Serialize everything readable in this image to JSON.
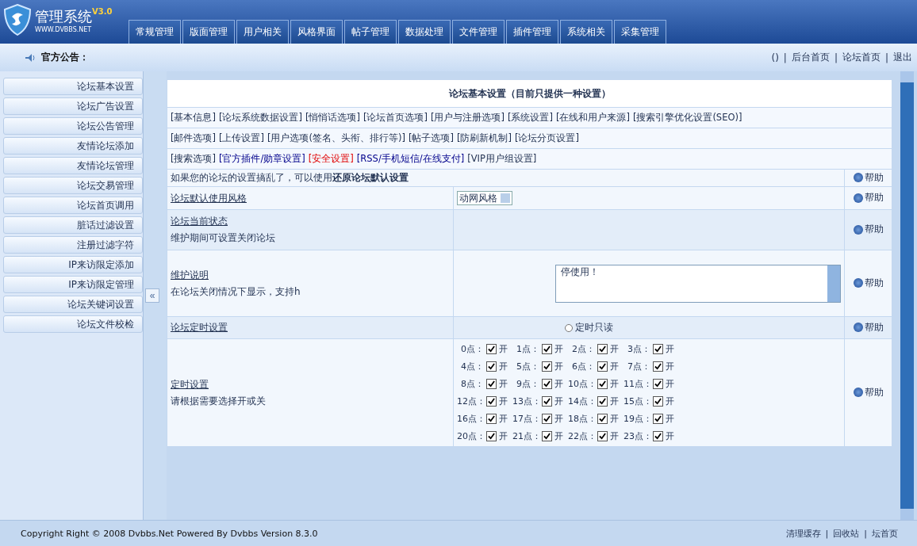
{
  "header": {
    "title": "管理系统",
    "version": "V3.0",
    "site": "WWW.DVBBS.NET",
    "tabs": [
      "常规管理",
      "版面管理",
      "用户相关",
      "风格界面",
      "帖子管理",
      "数据处理",
      "文件管理",
      "插件管理",
      "系统相关",
      "采集管理"
    ]
  },
  "notice_bar": {
    "label": "官方公告：",
    "separator": "|",
    "links": [
      "()",
      "后台首页",
      "论坛首页",
      "退出"
    ]
  },
  "sidebar": {
    "items": [
      "论坛基本设置",
      "论坛广告设置",
      "论坛公告管理",
      "友情论坛添加",
      "友情论坛管理",
      "论坛交易管理",
      "论坛首页调用",
      "脏话过滤设置",
      "注册过滤字符",
      "IP来访限定添加",
      "IP来访限定管理",
      "论坛关键词设置",
      "论坛文件校检"
    ],
    "collapse": "«"
  },
  "panel": {
    "title": "论坛基本设置（目前只提供一种设置）",
    "link_rows": [
      [
        {
          "text": "[基本信息]",
          "kind": "plain"
        },
        {
          "text": "[论坛系统数据设置]",
          "kind": "plain"
        },
        {
          "text": "[悄悄话选项]",
          "kind": "plain"
        },
        {
          "text": "[论坛首页选项]",
          "kind": "plain"
        },
        {
          "text": "[用户与注册选项]",
          "kind": "plain"
        },
        {
          "text": "[系统设置]",
          "kind": "plain"
        },
        {
          "text": "[在线和用户来源]",
          "kind": "plain"
        },
        {
          "text": "[搜索引擎优化设置(SEO)]",
          "kind": "plain"
        }
      ],
      [
        {
          "text": "[邮件选项]",
          "kind": "plain"
        },
        {
          "text": "[上传设置]",
          "kind": "plain"
        },
        {
          "text": "[用户选项(签名、头衔、排行等)]",
          "kind": "plain"
        },
        {
          "text": "[帖子选项]",
          "kind": "plain"
        },
        {
          "text": "[防刷新机制]",
          "kind": "plain"
        },
        {
          "text": "[论坛分页设置]",
          "kind": "plain"
        }
      ],
      [
        {
          "text": "[搜索选项]",
          "kind": "plain"
        },
        {
          "text": "[官方插件/勋章设置]",
          "kind": "featured"
        },
        {
          "text": "[安全设置]",
          "kind": "warning"
        },
        {
          "text": "[RSS/手机短信/在线支付]",
          "kind": "featured"
        },
        {
          "text": "[VIP用户组设置]",
          "kind": "plain"
        }
      ]
    ],
    "restore": {
      "text": "如果您的论坛的设置搞乱了，可以使用**还原论坛默认设置**",
      "help": "帮助"
    },
    "rows": [
      {
        "kind": "select",
        "label": "论坛默认使用风格",
        "value": "动网风格",
        "help": "帮助"
      },
      {
        "kind": "empty",
        "label": "论坛当前状态",
        "description": "维护期间可设置关闭论坛",
        "help": "帮助"
      },
      {
        "kind": "textarea",
        "label": "维护说明",
        "description": "在论坛关闭情况下显示，支持h",
        "value": "停使用！",
        "help": "帮助"
      },
      {
        "kind": "radio",
        "label": "论坛定时设置",
        "option": "定时只读",
        "selected": false,
        "help": "帮助"
      },
      {
        "kind": "hours",
        "label": "定时设置",
        "description": "请根据需要选择开或关",
        "help": "帮助",
        "hours": [
          {
            "label": "0点：",
            "checked": true,
            "text": "开"
          },
          {
            "label": "1点：",
            "checked": true,
            "text": "开"
          },
          {
            "label": "2点：",
            "checked": true,
            "text": "开"
          },
          {
            "label": "3点：",
            "checked": true,
            "text": "开"
          },
          {
            "label": "4点：",
            "checked": true,
            "text": "开"
          },
          {
            "label": "5点：",
            "checked": true,
            "text": "开"
          },
          {
            "label": "6点：",
            "checked": true,
            "text": "开"
          },
          {
            "label": "7点：",
            "checked": true,
            "text": "开"
          },
          {
            "label": "8点：",
            "checked": true,
            "text": "开"
          },
          {
            "label": "9点：",
            "checked": true,
            "text": "开"
          },
          {
            "label": "10点：",
            "checked": true,
            "text": "开"
          },
          {
            "label": "11点：",
            "checked": true,
            "text": "开"
          },
          {
            "label": "12点：",
            "checked": true,
            "text": "开"
          },
          {
            "label": "13点：",
            "checked": true,
            "text": "开"
          },
          {
            "label": "14点：",
            "checked": true,
            "text": "开"
          },
          {
            "label": "15点：",
            "checked": true,
            "text": "开"
          },
          {
            "label": "16点：",
            "checked": true,
            "text": "开"
          },
          {
            "label": "17点：",
            "checked": true,
            "text": "开"
          },
          {
            "label": "18点：",
            "checked": true,
            "text": "开"
          },
          {
            "label": "19点：",
            "checked": true,
            "text": "开"
          },
          {
            "label": "20点：",
            "checked": true,
            "text": "开"
          },
          {
            "label": "21点：",
            "checked": true,
            "text": "开"
          },
          {
            "label": "22点：",
            "checked": true,
            "text": "开"
          },
          {
            "label": "23点：",
            "checked": true,
            "text": "开"
          }
        ]
      }
    ]
  },
  "footer": {
    "copyright": "Copyright Right © 2008 Dvbbs.Net Powered By Dvbbs Version 8.3.0",
    "separator": "|",
    "links": [
      "清理缓存",
      "回收站",
      "坛首页"
    ]
  }
}
